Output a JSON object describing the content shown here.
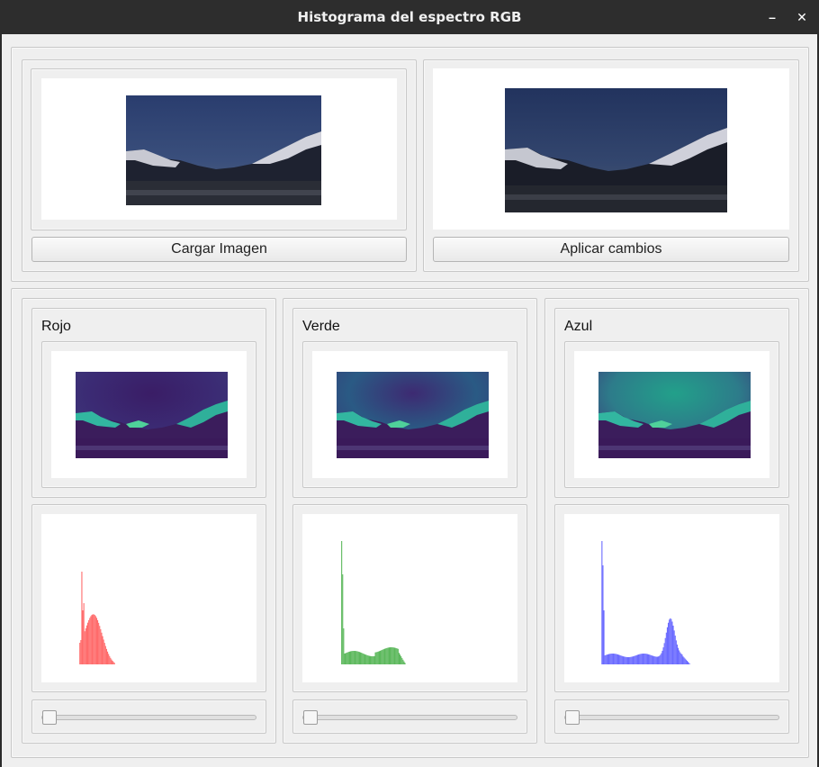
{
  "window": {
    "title": "Histograma del espectro RGB",
    "minimize_icon": "minimize-icon",
    "close_icon": "close-icon"
  },
  "top": {
    "load_button": "Cargar Imagen",
    "apply_button": "Aplicar cambios"
  },
  "channels": [
    {
      "label": "Rojo",
      "color": "#ff6b6b",
      "slider_value": 0
    },
    {
      "label": "Verde",
      "color": "#5cb85c",
      "slider_value": 0
    },
    {
      "label": "Azul",
      "color": "#6b6bff",
      "slider_value": 0
    }
  ]
}
